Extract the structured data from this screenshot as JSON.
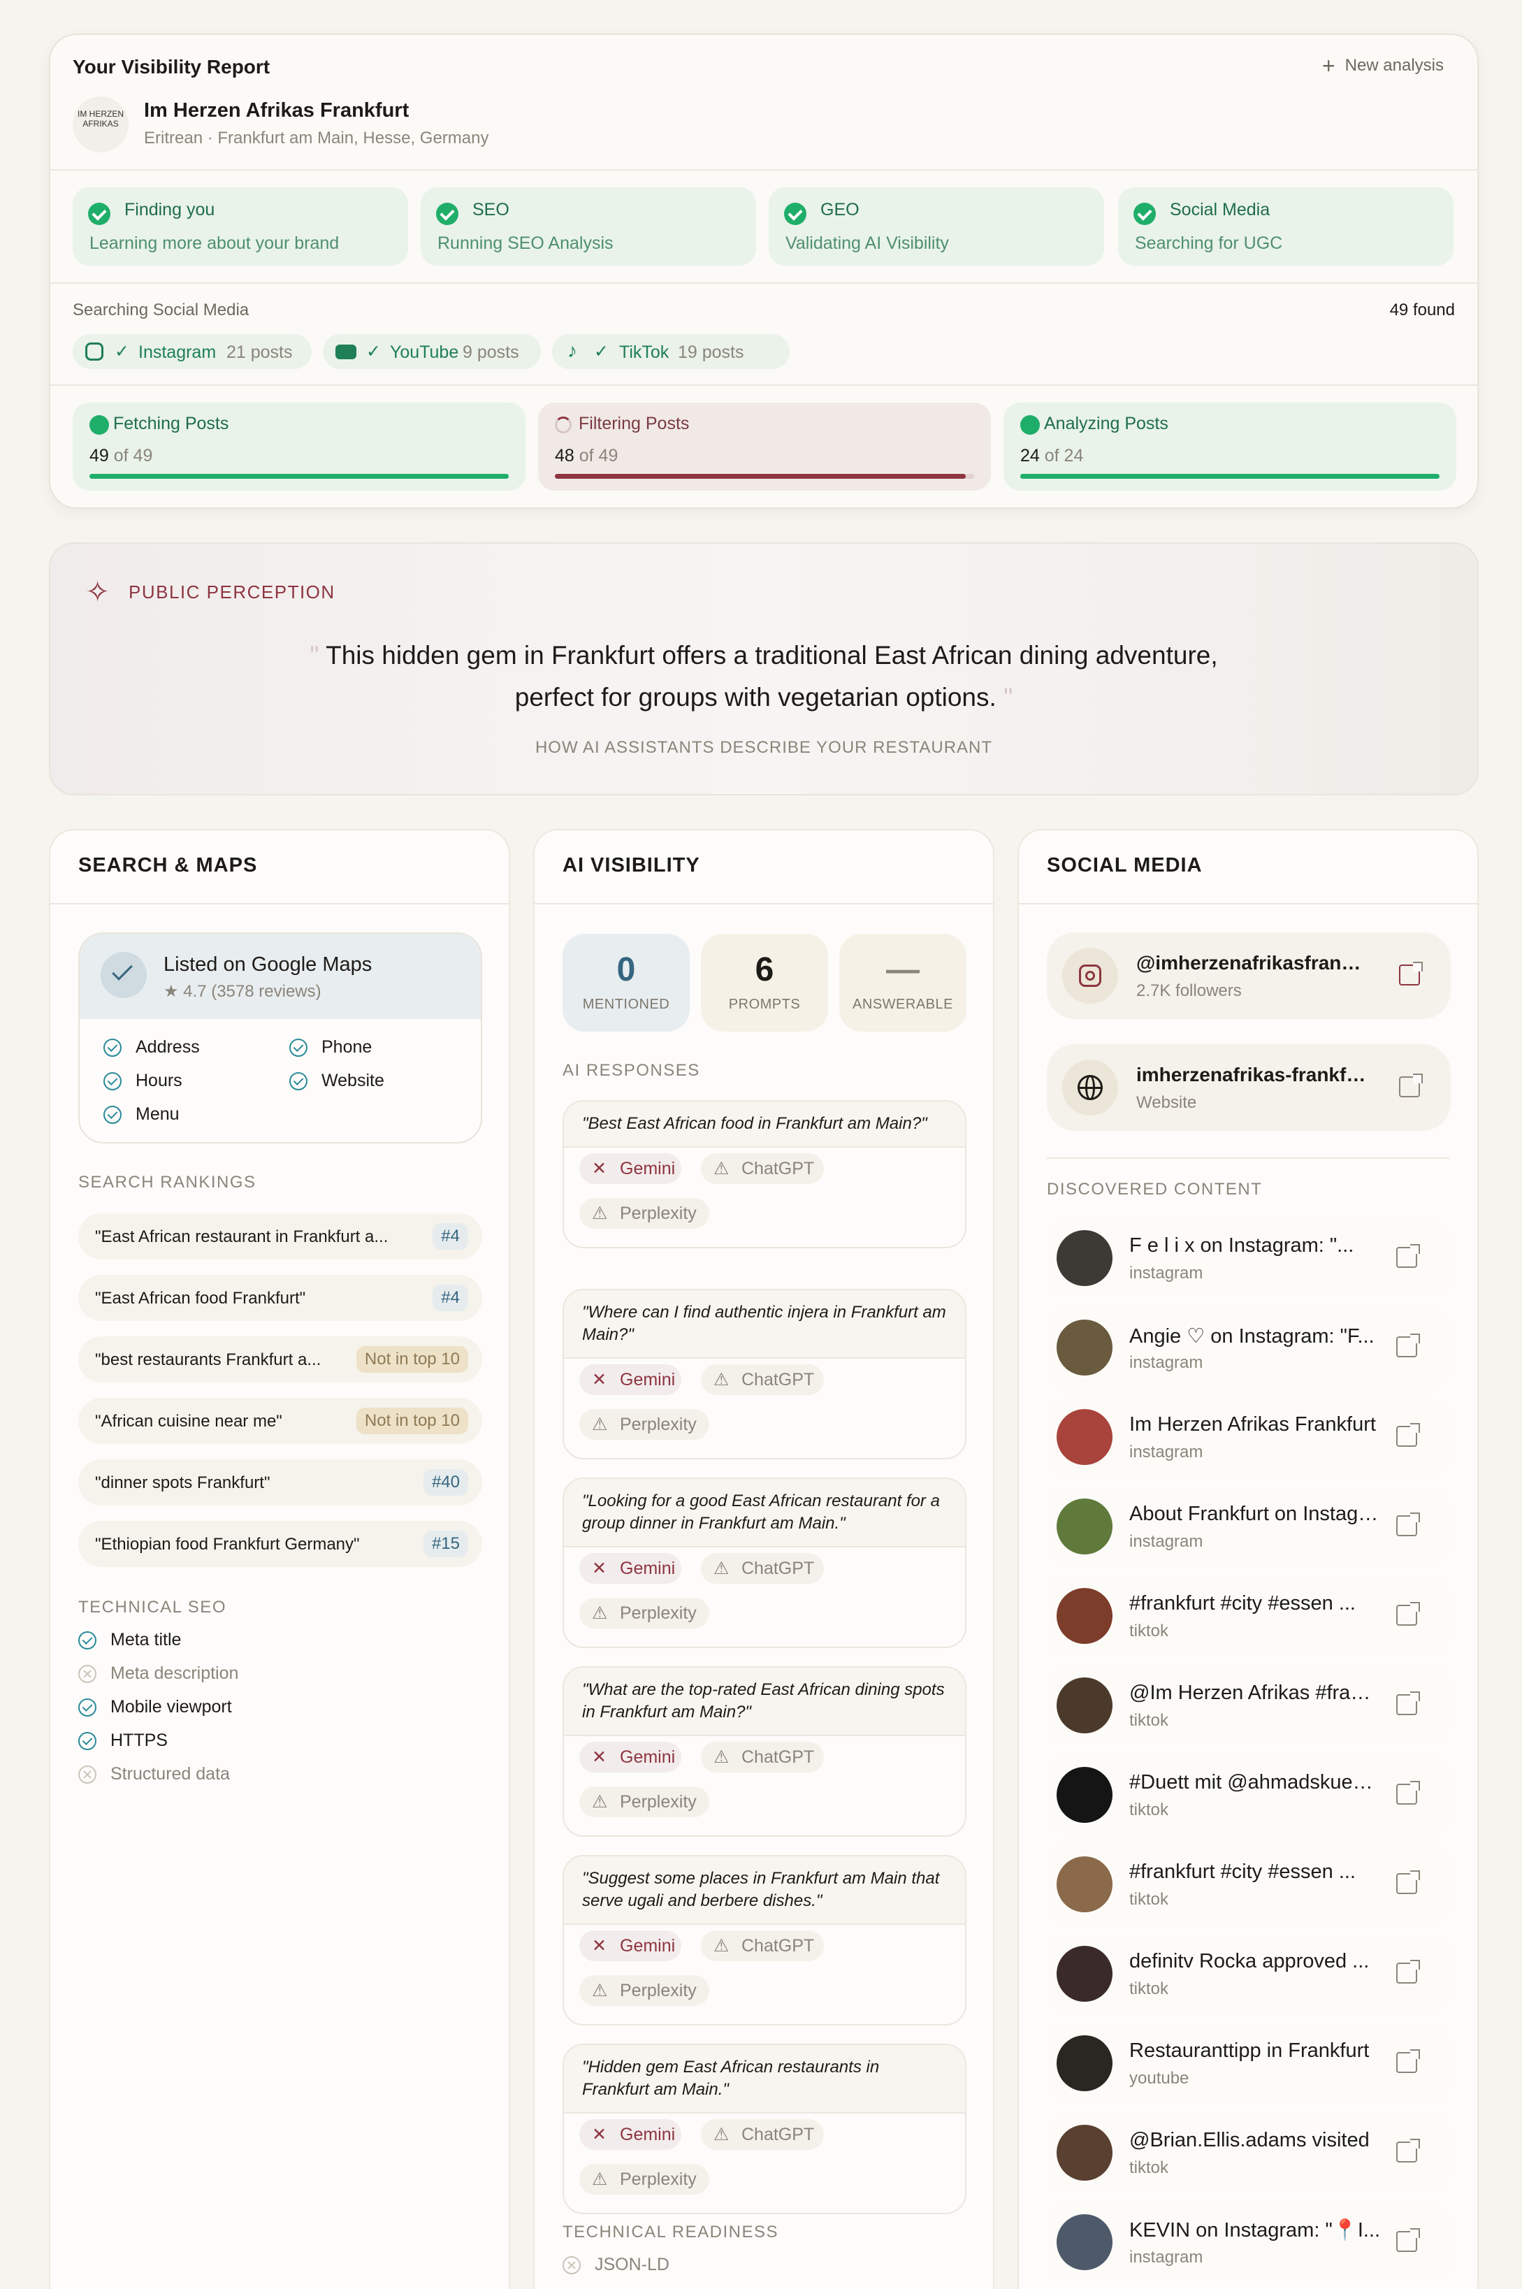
{
  "report": {
    "title": "Your Visibility Report",
    "new_analysis": "New analysis",
    "restaurant_name": "Im Herzen Afrikas Frankfurt",
    "restaurant_meta": "Eritrean · Frankfurt am Main, Hesse, Germany",
    "logo_text": "IM HERZEN AFRIKAS",
    "steps": [
      {
        "title": "Finding you",
        "sub": "Learning more about your brand"
      },
      {
        "title": "SEO",
        "sub": "Running SEO Analysis"
      },
      {
        "title": "GEO",
        "sub": "Validating AI Visibility"
      },
      {
        "title": "Social Media",
        "sub": "Searching for UGC"
      }
    ],
    "searching_label": "Searching Social Media",
    "found": "49 found",
    "platforms": [
      {
        "name": "Instagram",
        "count": "21 posts"
      },
      {
        "name": "YouTube",
        "count": "9 posts"
      },
      {
        "name": "TikTok",
        "count": "19 posts"
      }
    ],
    "progress": [
      {
        "title": "Fetching Posts",
        "done": "49",
        "total": "of 49",
        "fraction": 1.0,
        "color": "#1fae6a"
      },
      {
        "title": "Filtering Posts",
        "done": "48",
        "total": "of 49",
        "fraction": 0.98,
        "color": "#8d3540"
      },
      {
        "title": "Analyzing Posts",
        "done": "24",
        "total": "of 24",
        "fraction": 1.0,
        "color": "#1fae6a"
      }
    ]
  },
  "perception": {
    "label": "PUBLIC PERCEPTION",
    "quote_line1": "This hidden gem in Frankfurt offers a traditional East African dining adventure,",
    "quote_line2": "perfect for groups with vegetarian options.",
    "caption": "HOW AI ASSISTANTS DESCRIBE YOUR RESTAURANT"
  },
  "search": {
    "heading": "SEARCH & MAPS",
    "maps_title": "Listed on Google Maps",
    "maps_rating": "★ 4.7 (3578 reviews)",
    "maps_items": [
      "Address",
      "Phone",
      "Hours",
      "Website",
      "Menu"
    ],
    "rankings_label": "SEARCH RANKINGS",
    "rankings": [
      {
        "query": "\"East African restaurant in Frankfurt a...",
        "badge": "#4"
      },
      {
        "query": "\"East African food Frankfurt\"",
        "badge": "#4"
      },
      {
        "query": "\"best restaurants Frankfurt a...",
        "badge": "Not in top 10"
      },
      {
        "query": "\"African cuisine near me\"",
        "badge": "Not in top 10"
      },
      {
        "query": "\"dinner spots Frankfurt\"",
        "badge": "#40"
      },
      {
        "query": "\"Ethiopian food Frankfurt Germany\"",
        "badge": "#15"
      }
    ],
    "tech_label": "TECHNICAL SEO",
    "tech": [
      "Meta title",
      "Meta description",
      "Mobile viewport",
      "HTTPS",
      "Structured data"
    ]
  },
  "ai": {
    "heading": "AI VISIBILITY",
    "stats": [
      {
        "value": "0",
        "caption": "MENTIONED"
      },
      {
        "value": "6",
        "caption": "PROMPTS"
      },
      {
        "value": "—",
        "caption": "ANSWERABLE"
      }
    ],
    "responses_label": "AI RESPONSES",
    "responses": [
      "\"Best East African food in Frankfurt am Main?\"",
      "\"Where can I find authentic injera in Frankfurt am Main?\"",
      "\"Looking for a good East African restaurant for a group dinner in Frankfurt am Main.\"",
      "\"What are the top-rated East African dining spots in Frankfurt am Main?\"",
      "\"Suggest some places in Frankfurt am Main that serve ugali and berbere dishes.\"",
      "\"Hidden gem East African restaurants in Frankfurt am Main.\""
    ],
    "engines": [
      "Gemini",
      "ChatGPT",
      "Perplexity"
    ],
    "tech_label": "TECHNICAL READINESS",
    "tech_item": "JSON-LD"
  },
  "social": {
    "heading": "SOCIAL MEDIA",
    "accounts": [
      {
        "handle": "@imherzenafrikasfrankfurt",
        "sub": "2.7K followers"
      },
      {
        "handle": "imherzenafrikas-frankfurt.de",
        "sub": "Website"
      }
    ],
    "discovered_label": "DISCOVERED CONTENT",
    "items": [
      {
        "title": "F e l i x on Instagram: \"...",
        "source": "instagram"
      },
      {
        "title": "Angie ♡ on Instagram: \"F...",
        "source": "instagram"
      },
      {
        "title": "Im Herzen Afrikas Frankfurt",
        "source": "instagram"
      },
      {
        "title": "About Frankfurt on Instagram",
        "source": "instagram"
      },
      {
        "title": "#frankfurt #city #essen ...",
        "source": "tiktok"
      },
      {
        "title": "@Im Herzen Afrikas #frankfurt",
        "source": "tiktok"
      },
      {
        "title": "#Duett mit @ahmadskuechen",
        "source": "tiktok"
      },
      {
        "title": "#frankfurt #city #essen ...",
        "source": "tiktok"
      },
      {
        "title": "definitv Rocka approved ...",
        "source": "tiktok"
      },
      {
        "title": "Restauranttipp in Frankfurt",
        "source": "youtube"
      },
      {
        "title": "@Brian.Ellis.adams visited",
        "source": "tiktok"
      },
      {
        "title": "KEVIN on Instagram: \"📍I...",
        "source": "instagram"
      }
    ]
  }
}
